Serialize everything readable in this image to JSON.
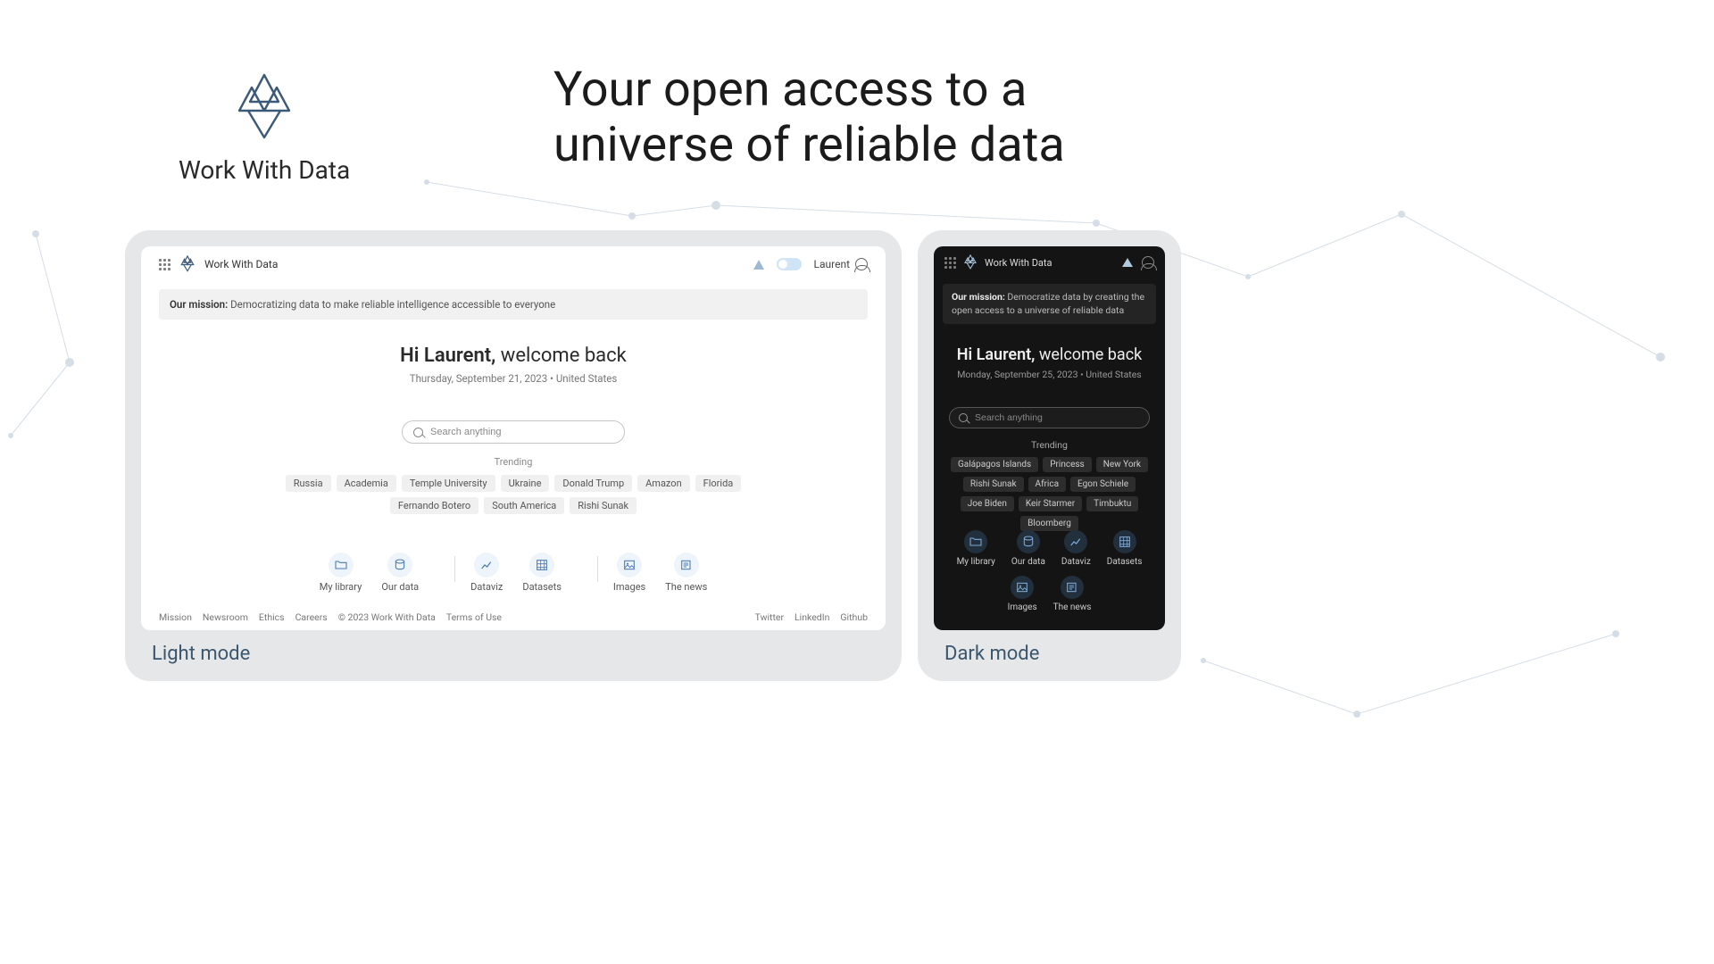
{
  "hero": {
    "brand": "Work With Data",
    "tagline_line1": "Your open access to a",
    "tagline_line2": "universe of reliable data"
  },
  "light": {
    "caption": "Light mode",
    "header": {
      "brand": "Work With Data",
      "user": "Laurent"
    },
    "mission_label": "Our mission:",
    "mission_text": "Democratizing data to make reliable intelligence accessible to everyone",
    "greeting_bold": "Hi Laurent,",
    "greeting_rest": "welcome back",
    "date": "Thursday, September 21, 2023 • United States",
    "search_placeholder": "Search anything",
    "trending_label": "Trending",
    "trending": [
      "Russia",
      "Academia",
      "Temple University",
      "Ukraine",
      "Donald Trump",
      "Amazon",
      "Florida",
      "Fernando Botero",
      "South America",
      "Rishi Sunak"
    ],
    "nav": {
      "g1": [
        {
          "icon": "folder",
          "label": "My library"
        },
        {
          "icon": "database",
          "label": "Our data"
        }
      ],
      "g2": [
        {
          "icon": "chart",
          "label": "Dataviz"
        },
        {
          "icon": "grid",
          "label": "Datasets"
        }
      ],
      "g3": [
        {
          "icon": "image",
          "label": "Images"
        },
        {
          "icon": "news",
          "label": "The news"
        }
      ]
    },
    "footer_left": [
      "Mission",
      "Newsroom",
      "Ethics",
      "Careers"
    ],
    "footer_copy": "© 2023 Work With Data",
    "footer_terms": "Terms of Use",
    "footer_right": [
      "Twitter",
      "LinkedIn",
      "Github"
    ]
  },
  "dark": {
    "caption": "Dark mode",
    "header_brand": "Work With Data",
    "mission_label": "Our mission:",
    "mission_text": "Democratize data by creating the open access to a universe of reliable data",
    "greeting_bold": "Hi Laurent,",
    "greeting_rest": "welcome back",
    "date": "Monday, September 25, 2023 • United States",
    "search_placeholder": "Search anything",
    "trending_label": "Trending",
    "trending": [
      "Galápagos Islands",
      "Princess",
      "New York",
      "Rishi Sunak",
      "Africa",
      "Egon Schiele",
      "Joe Biden",
      "Keir Starmer",
      "Timbuktu",
      "Bloomberg"
    ],
    "nav_row1": [
      {
        "icon": "folder",
        "label": "My library"
      },
      {
        "icon": "database",
        "label": "Our data"
      },
      {
        "icon": "chart",
        "label": "Dataviz"
      },
      {
        "icon": "grid",
        "label": "Datasets"
      }
    ],
    "nav_row2": [
      {
        "icon": "image",
        "label": "Images"
      },
      {
        "icon": "news",
        "label": "The news"
      }
    ]
  }
}
